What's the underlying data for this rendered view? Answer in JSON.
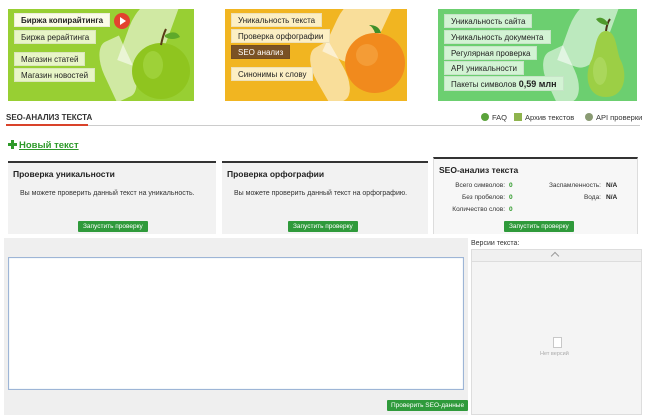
{
  "banners": {
    "left": {
      "items": [
        "Биржа копирайтинга",
        "Биржа рерайтинга",
        "Магазин статей",
        "Магазин новостей"
      ],
      "bg": "#98cf33"
    },
    "mid": {
      "items": [
        "Уникальность текста",
        "Проверка орфографии",
        "SEO анализ",
        "Синонимы к слову"
      ],
      "bg": "#f1b521"
    },
    "right": {
      "items": [
        "Уникальность сайта",
        "Уникальность документа",
        "Регулярная проверка",
        "API уникальности"
      ],
      "packets_label": "Пакеты символов",
      "packets_value": "0,59 млн",
      "bg": "#6ccf70"
    }
  },
  "section": {
    "title": "SEO-АНАЛИЗ ТЕКСТА",
    "nav": {
      "faq": "FAQ",
      "archive": "Архив текстов",
      "api": "API проверки"
    }
  },
  "new_text": "Новый текст",
  "cards": {
    "uniqueness": {
      "title": "Проверка уникальности",
      "desc": "Вы можете проверить данный текст на уникальность.",
      "button": "Запустить проверку"
    },
    "spelling": {
      "title": "Проверка орфографии",
      "desc": "Вы можете проверить данный текст на орфографию.",
      "button": "Запустить проверку"
    },
    "seo": {
      "title": "SEO-анализ текста",
      "total_chars_label": "Всего символов:",
      "total_chars": "0",
      "no_spaces_label": "Без пробелов:",
      "no_spaces": "0",
      "words_label": "Количество слов:",
      "words": "0",
      "spam_label": "Заспамленность:",
      "spam": "N/A",
      "water_label": "Вода:",
      "water": "N/A",
      "button": "Запустить проверку"
    }
  },
  "editor": {
    "text": "",
    "button": "Проверить SEO-данные"
  },
  "versions": {
    "label": "Версии текста:",
    "empty": "Нет версий"
  },
  "colors": {
    "accent_green": "#2f9a3b",
    "underline_red": "#d9432a"
  }
}
